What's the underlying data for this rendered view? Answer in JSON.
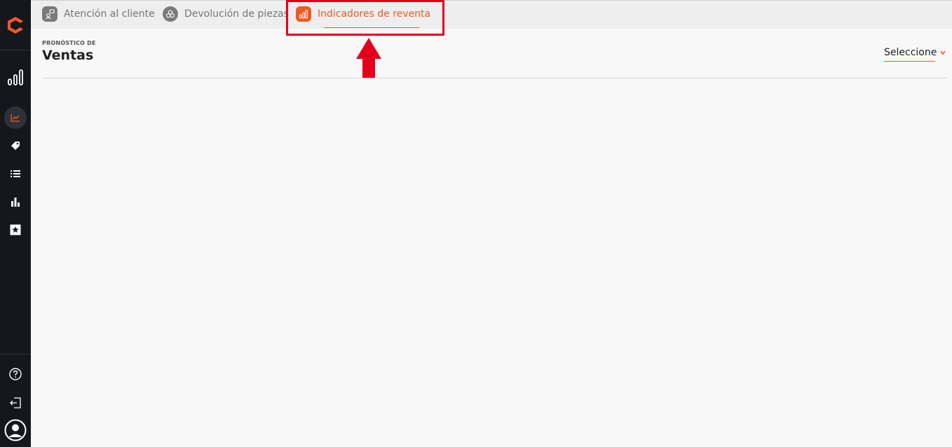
{
  "tabs": [
    {
      "label": "Atención al cliente",
      "icon": "customer-service-icon"
    },
    {
      "label": "Devolución de piezas",
      "icon": "parts-return-icon"
    },
    {
      "label": "Indicadores de reventa",
      "icon": "bar-chart-icon",
      "active": true
    }
  ],
  "header": {
    "kicker": "PRONÓSTICO DE",
    "title": "Ventas"
  },
  "selector": {
    "label": "Seleccione"
  },
  "sidebar": {
    "items": [
      "indicators-icon",
      "line-chart-icon",
      "tag-icon",
      "list-icon",
      "bar-chart-icon",
      "star-icon"
    ],
    "bottom": [
      "help-icon",
      "logout-icon",
      "user-avatar-icon"
    ]
  },
  "colors": {
    "accent": "#f05a22",
    "sidebar_bg": "#14171c",
    "highlight": "#e4001b"
  }
}
